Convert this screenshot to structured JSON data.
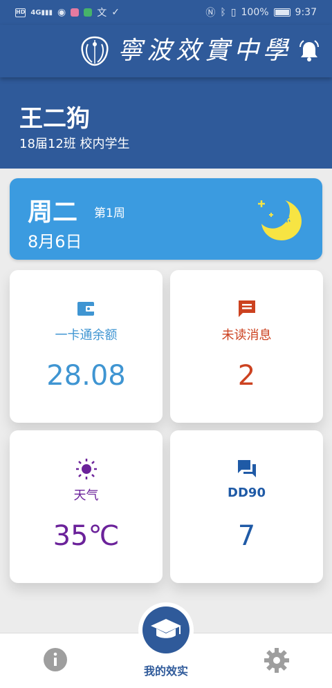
{
  "status_bar": {
    "left_icons": [
      "hd-icon",
      "signal-4g-icon",
      "wifi-eye-icon",
      "app-icon-pink",
      "app-icon-green",
      "translate-icon",
      "check-icon"
    ],
    "battery": "100%",
    "time": "9:37"
  },
  "header": {
    "school_name": "寧波效實中學"
  },
  "profile": {
    "name": "王二狗",
    "class_info": "18届12班 校内学生"
  },
  "date_card": {
    "weekday": "周二",
    "week_no": "第1周",
    "date": "8月6日"
  },
  "tiles": {
    "balance": {
      "label": "一卡通余额",
      "value": "28.08",
      "color": "#3f95d2",
      "icon": "wallet-icon"
    },
    "messages": {
      "label": "未读消息",
      "value": "2",
      "color": "#cc4220",
      "icon": "message-icon"
    },
    "weather": {
      "label": "天气",
      "value": "35℃",
      "color": "#6b229a",
      "icon": "sun-icon"
    },
    "dd": {
      "label": "DD90",
      "value": "7",
      "color": "#1f5aa6",
      "icon": "chat-icon"
    }
  },
  "bottom_nav": {
    "home_label": "我的效实"
  },
  "colors": {
    "primary": "#2f5a9a",
    "date_card": "#3b9be0",
    "moon": "#f7e443"
  }
}
